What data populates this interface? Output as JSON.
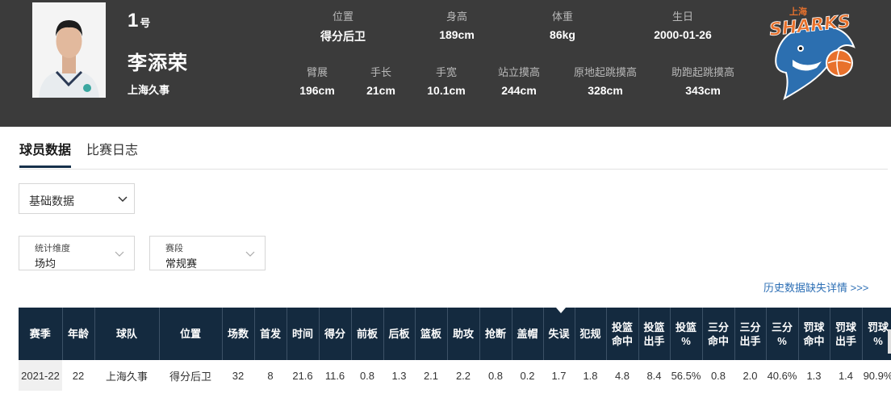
{
  "player": {
    "number": "1",
    "number_suffix": "号",
    "name": "李添荣",
    "team": "上海久事"
  },
  "attributes_row1": [
    {
      "label": "位置",
      "value": "得分后卫"
    },
    {
      "label": "身高",
      "value": "189cm"
    },
    {
      "label": "体重",
      "value": "86kg"
    },
    {
      "label": "生日",
      "value": "2000-01-26"
    }
  ],
  "attributes_row2": [
    {
      "label": "臂展",
      "value": "196cm"
    },
    {
      "label": "手长",
      "value": "21cm"
    },
    {
      "label": "手宽",
      "value": "10.1cm"
    },
    {
      "label": "站立摸高",
      "value": "244cm"
    },
    {
      "label": "原地起跳摸高",
      "value": "328cm"
    },
    {
      "label": "助跑起跳摸高",
      "value": "343cm"
    }
  ],
  "logo": {
    "text_top": "上海",
    "text_main": "SHARKS"
  },
  "tabs": [
    {
      "label": "球员数据",
      "active": true
    },
    {
      "label": "比赛日志",
      "active": false
    }
  ],
  "data_type_select": {
    "value": "基础数据"
  },
  "filters": [
    {
      "label": "统计维度",
      "value": "场均"
    },
    {
      "label": "赛段",
      "value": "常规赛"
    }
  ],
  "history_link": "历史数据缺失详情 >>>",
  "table": {
    "headers": [
      [
        "赛季"
      ],
      [
        "年龄"
      ],
      [
        "球队"
      ],
      [
        "位置"
      ],
      [
        "场数"
      ],
      [
        "首发"
      ],
      [
        "时间"
      ],
      [
        "得分"
      ],
      [
        "前板"
      ],
      [
        "后板"
      ],
      [
        "篮板"
      ],
      [
        "助攻"
      ],
      [
        "抢断"
      ],
      [
        "盖帽"
      ],
      [
        "失误"
      ],
      [
        "犯规"
      ],
      [
        "投篮",
        "命中"
      ],
      [
        "投篮",
        "出手"
      ],
      [
        "投篮",
        "%"
      ],
      [
        "三分",
        "命中"
      ],
      [
        "三分",
        "出手"
      ],
      [
        "三分",
        "%"
      ],
      [
        "罚球",
        "命中"
      ],
      [
        "罚球",
        "出手"
      ],
      [
        "罚球",
        "%"
      ]
    ],
    "rows": [
      [
        "2021-22",
        "22",
        "上海久事",
        "得分后卫",
        "32",
        "8",
        "21.6",
        "11.6",
        "0.8",
        "1.3",
        "2.1",
        "2.2",
        "0.8",
        "0.2",
        "1.7",
        "1.8",
        "4.8",
        "8.4",
        "56.5%",
        "0.8",
        "2.0",
        "40.6%",
        "1.3",
        "1.4",
        "90.9%"
      ]
    ]
  }
}
